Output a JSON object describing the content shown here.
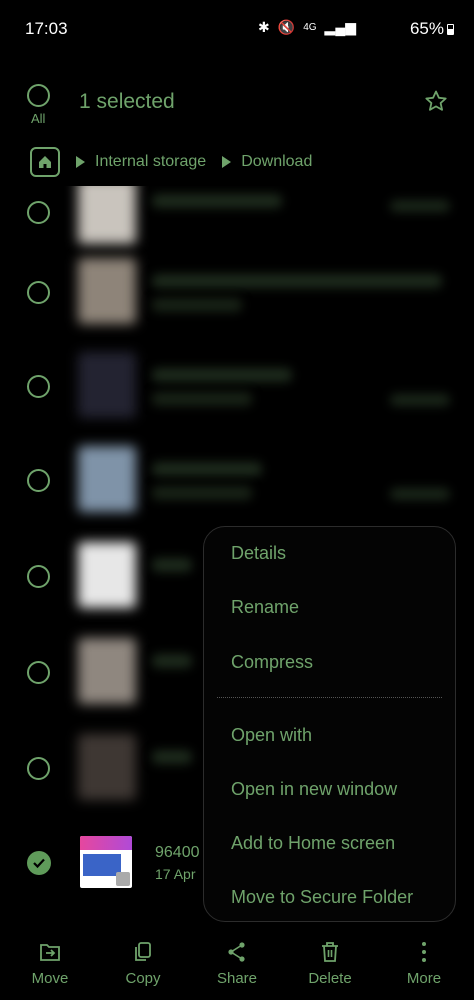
{
  "status_bar": {
    "time": "17:03",
    "network": "4G",
    "battery": "65%"
  },
  "header": {
    "all_label": "All",
    "title": "1 selected"
  },
  "breadcrumb": {
    "items": [
      "Internal storage",
      "Download"
    ]
  },
  "selected_file": {
    "name": "96400",
    "date": "17 Apr"
  },
  "context_menu": {
    "items": [
      "Details",
      "Rename",
      "Compress",
      "Open with",
      "Open in new window",
      "Add to Home screen",
      "Move to Secure Folder"
    ]
  },
  "bottom_bar": {
    "items": [
      {
        "label": "Move",
        "icon": "move-icon"
      },
      {
        "label": "Copy",
        "icon": "copy-icon"
      },
      {
        "label": "Share",
        "icon": "share-icon"
      },
      {
        "label": "Delete",
        "icon": "trash-icon"
      },
      {
        "label": "More",
        "icon": "more-vertical-icon"
      }
    ]
  },
  "colors": {
    "accent": "#6fa36b",
    "background": "#000000"
  }
}
